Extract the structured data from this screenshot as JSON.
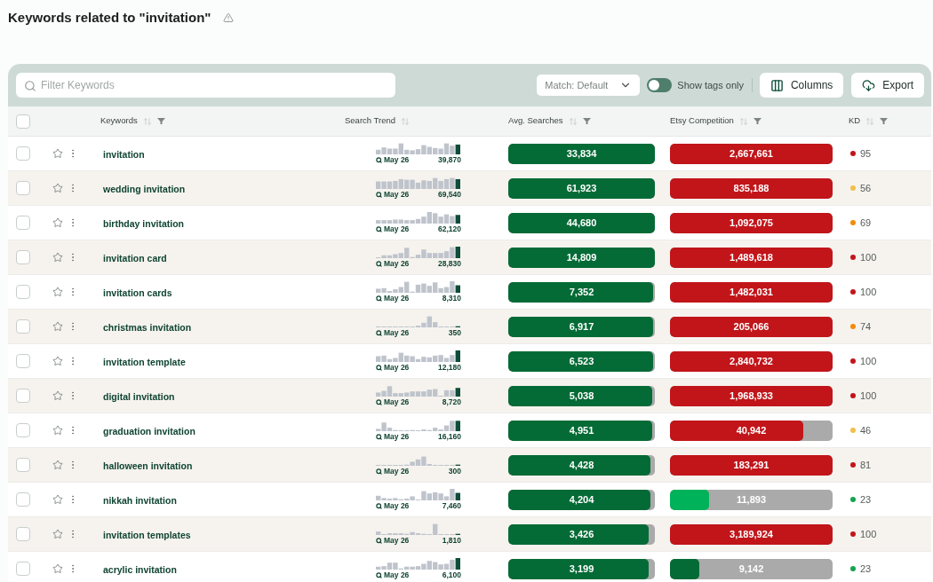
{
  "page": {
    "title": "Keywords related to \"invitation\""
  },
  "toolbar": {
    "filter": {
      "placeholder": "Filter Keywords"
    },
    "match_dropdown": {
      "value": "Match: Default"
    },
    "show_tags_toggle": {
      "label": "Show tags only",
      "on": false
    },
    "buttons": [
      {
        "label": "Columns",
        "kind": "columns"
      },
      {
        "label": "Export",
        "kind": "export"
      }
    ]
  },
  "table": {
    "header_checkbox": {
      "checked": false
    },
    "columns": [
      {
        "label": "Keywords",
        "filterable": true
      },
      {
        "label": "Search Trend",
        "filterable": false
      },
      {
        "label": "Avg. Searches",
        "filterable": true
      },
      {
        "label": "Etsy Competition",
        "filterable": true
      },
      {
        "label": "KD",
        "filterable": true
      }
    ],
    "rows": [
      {
        "checked": false,
        "starred": false,
        "keyword": "invitation",
        "trend_date": "May 26",
        "trend_value": "39,870",
        "avg_searches": {
          "value": "33,834",
          "level": 1
        },
        "competition": {
          "value": "2,667,661",
          "level": 1,
          "color": "#c1151a"
        },
        "kd": {
          "value": "95",
          "color": "#c1151a"
        }
      },
      {
        "checked": false,
        "starred": false,
        "keyword": "wedding invitation",
        "trend_date": "May 26",
        "trend_value": "69,540",
        "avg_searches": {
          "value": "61,923",
          "level": 1
        },
        "competition": {
          "value": "835,188",
          "level": 1,
          "color": "#c1151a"
        },
        "kd": {
          "value": "56",
          "color": "#f2bf4a"
        }
      },
      {
        "checked": false,
        "starred": false,
        "keyword": "birthday invitation",
        "trend_date": "May 26",
        "trend_value": "62,120",
        "avg_searches": {
          "value": "44,680",
          "level": 1
        },
        "competition": {
          "value": "1,092,075",
          "level": 1,
          "color": "#c1151a"
        },
        "kd": {
          "value": "69",
          "color": "#f28b0c"
        }
      },
      {
        "checked": false,
        "starred": false,
        "keyword": "invitation card",
        "trend_date": "May 26",
        "trend_value": "28,830",
        "avg_searches": {
          "value": "14,809",
          "level": 1
        },
        "competition": {
          "value": "1,489,618",
          "level": 1,
          "color": "#c1151a"
        },
        "kd": {
          "value": "100",
          "color": "#c1151a"
        }
      },
      {
        "checked": false,
        "starred": false,
        "keyword": "invitation cards",
        "trend_date": "May 26",
        "trend_value": "8,310",
        "avg_searches": {
          "value": "7,352",
          "level": 0.99
        },
        "competition": {
          "value": "1,482,031",
          "level": 1,
          "color": "#c1151a"
        },
        "kd": {
          "value": "100",
          "color": "#c1151a"
        }
      },
      {
        "checked": false,
        "starred": false,
        "keyword": "christmas invitation",
        "trend_date": "May 26",
        "trend_value": "350",
        "avg_searches": {
          "value": "6,917",
          "level": 0.99
        },
        "competition": {
          "value": "205,066",
          "level": 1,
          "color": "#c1151a"
        },
        "kd": {
          "value": "74",
          "color": "#f28b0c"
        }
      },
      {
        "checked": false,
        "starred": false,
        "keyword": "invitation template",
        "trend_date": "May 26",
        "trend_value": "12,180",
        "avg_searches": {
          "value": "6,523",
          "level": 0.99
        },
        "competition": {
          "value": "2,840,732",
          "level": 1,
          "color": "#c1151a"
        },
        "kd": {
          "value": "100",
          "color": "#c1151a"
        }
      },
      {
        "checked": false,
        "starred": false,
        "keyword": "digital invitation",
        "trend_date": "May 26",
        "trend_value": "8,720",
        "avg_searches": {
          "value": "5,038",
          "level": 0.98
        },
        "competition": {
          "value": "1,968,933",
          "level": 1,
          "color": "#c1151a"
        },
        "kd": {
          "value": "100",
          "color": "#c1151a"
        }
      },
      {
        "checked": false,
        "starred": false,
        "keyword": "graduation invitation",
        "trend_date": "May 26",
        "trend_value": "16,160",
        "avg_searches": {
          "value": "4,951",
          "level": 0.98
        },
        "competition": {
          "value": "40,942",
          "level": 0.82,
          "color": "#c1151a"
        },
        "kd": {
          "value": "46",
          "color": "#f2bf4a"
        }
      },
      {
        "checked": false,
        "starred": false,
        "keyword": "halloween invitation",
        "trend_date": "May 26",
        "trend_value": "300",
        "avg_searches": {
          "value": "4,428",
          "level": 0.97
        },
        "competition": {
          "value": "183,291",
          "level": 1,
          "color": "#c1151a"
        },
        "kd": {
          "value": "81",
          "color": "#c1151a"
        }
      },
      {
        "checked": false,
        "starred": false,
        "keyword": "nikkah invitation",
        "trend_date": "May 26",
        "trend_value": "7,460",
        "avg_searches": {
          "value": "4,204",
          "level": 0.97
        },
        "competition": {
          "value": "11,893",
          "level": 0.24,
          "color": "#00b259"
        },
        "kd": {
          "value": "23",
          "color": "#14a352"
        }
      },
      {
        "checked": false,
        "starred": false,
        "keyword": "invitation templates",
        "trend_date": "May 26",
        "trend_value": "1,810",
        "avg_searches": {
          "value": "3,426",
          "level": 0.96
        },
        "competition": {
          "value": "3,189,924",
          "level": 1,
          "color": "#c1151a"
        },
        "kd": {
          "value": "100",
          "color": "#c1151a"
        }
      },
      {
        "checked": false,
        "starred": false,
        "keyword": "acrylic invitation",
        "trend_date": "May 26",
        "trend_value": "6,100",
        "avg_searches": {
          "value": "3,199",
          "level": 0.96
        },
        "competition": {
          "value": "9,142",
          "level": 0.18,
          "color": "#056b36"
        },
        "kd": {
          "value": "23",
          "color": "#14a352"
        }
      }
    ]
  }
}
